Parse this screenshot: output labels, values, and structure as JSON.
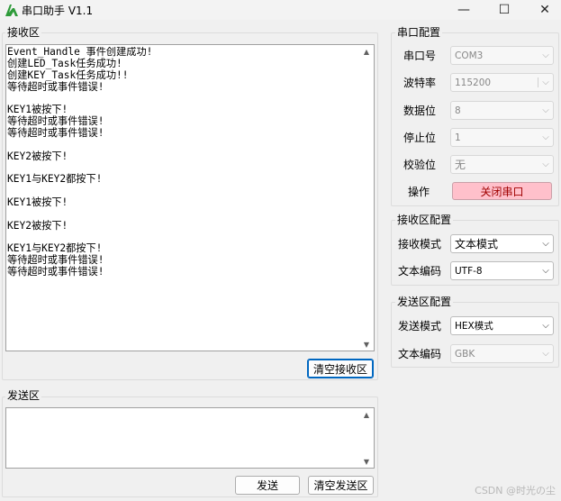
{
  "window": {
    "title": "串口助手 V1.1",
    "minimize_glyph": "—",
    "maximize_glyph": "☐",
    "close_glyph": "✕",
    "app_icon": "green-a-logo-icon"
  },
  "receive_area": {
    "title": "接收区",
    "lines": [
      "Event_Handle 事件创建成功!",
      "创建LED_Task任务成功!",
      "创建KEY_Task任务成功!!",
      "等待超时或事件错误!",
      "",
      "KEY1被按下!",
      "等待超时或事件错误!",
      "等待超时或事件错误!",
      "",
      "KEY2被按下!",
      "",
      "KEY1与KEY2都按下!",
      "",
      "KEY1被按下!",
      "",
      "KEY2被按下!",
      "",
      "KEY1与KEY2都按下!",
      "等待超时或事件错误!",
      "等待超时或事件错误!"
    ],
    "clear_button": "清空接收区"
  },
  "send_area": {
    "title": "发送区",
    "value": "",
    "send_button": "发送",
    "clear_button": "清空发送区"
  },
  "port_config": {
    "title": "串口配置",
    "port": {
      "label": "串口号",
      "value": "COM3"
    },
    "baud": {
      "label": "波特率",
      "value": "115200"
    },
    "data_bits": {
      "label": "数据位",
      "value": "8"
    },
    "stop_bits": {
      "label": "停止位",
      "value": "1"
    },
    "parity": {
      "label": "校验位",
      "value": "无"
    },
    "operation": {
      "label": "操作",
      "button": "关闭串口",
      "button_color": "#ffc0cb"
    }
  },
  "recv_config": {
    "title": "接收区配置",
    "mode": {
      "label": "接收模式",
      "value": "文本模式"
    },
    "encoding": {
      "label": "文本编码",
      "value": "UTF-8"
    }
  },
  "send_config": {
    "title": "发送区配置",
    "mode": {
      "label": "发送模式",
      "value": "HEX模式"
    },
    "encoding": {
      "label": "文本编码",
      "value": "GBK"
    }
  },
  "watermark": "CSDN @时光の尘"
}
